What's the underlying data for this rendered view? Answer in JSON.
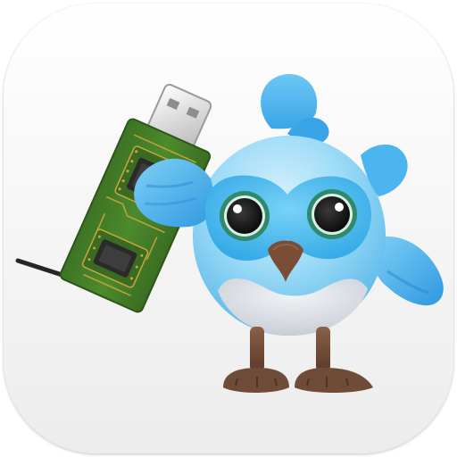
{
  "app_icon": {
    "name": "bird-mascot-with-usb-dongle",
    "colors": {
      "background_top": "#ffffff",
      "background_bottom": "#ececec",
      "board_green": "#4c8a2c",
      "board_dark": "#335f1c",
      "gold_trace": "#c9a63a",
      "usb_metal": "#e8e8e8",
      "antenna": "#2a2a2a",
      "feather_light": "#9fdcf7",
      "feather_blue": "#4cb4ee",
      "wing_blue": "#38a6ea",
      "face_mask": "#52c0ef",
      "eye_ring": "#2f8a6b",
      "belly": "#dcdfe6",
      "beak": "#7a4e35",
      "legs": "#6e4c38"
    }
  }
}
